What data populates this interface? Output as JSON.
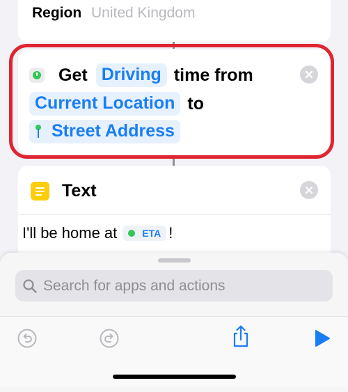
{
  "region": {
    "label": "Region",
    "value": "United Kingdom"
  },
  "get_action": {
    "verb": "Get",
    "mode": "Driving",
    "mid_text": "time from",
    "origin": "Current Location",
    "to_text": "to",
    "destination": "Street Address",
    "icon": "clock-icon",
    "destination_icon": "map-pin-icon",
    "remove_icon": "close-icon"
  },
  "text_action": {
    "title": "Text",
    "icon": "notes-icon",
    "body_prefix": "I'll be home at",
    "variable": "ETA",
    "body_suffix": "!",
    "remove_icon": "close-icon"
  },
  "search": {
    "placeholder": "Search for apps and actions"
  },
  "toolbar": {
    "undo_icon": "undo-icon",
    "redo_icon": "redo-icon",
    "share_icon": "share-icon",
    "run_icon": "play-icon"
  },
  "colors": {
    "accent": "#1a7ef3",
    "highlight_ring": "#e02531",
    "token_background": "#e7f1fe",
    "notes_yellow": "#fdcc0a",
    "clock_green": "#32c759"
  }
}
